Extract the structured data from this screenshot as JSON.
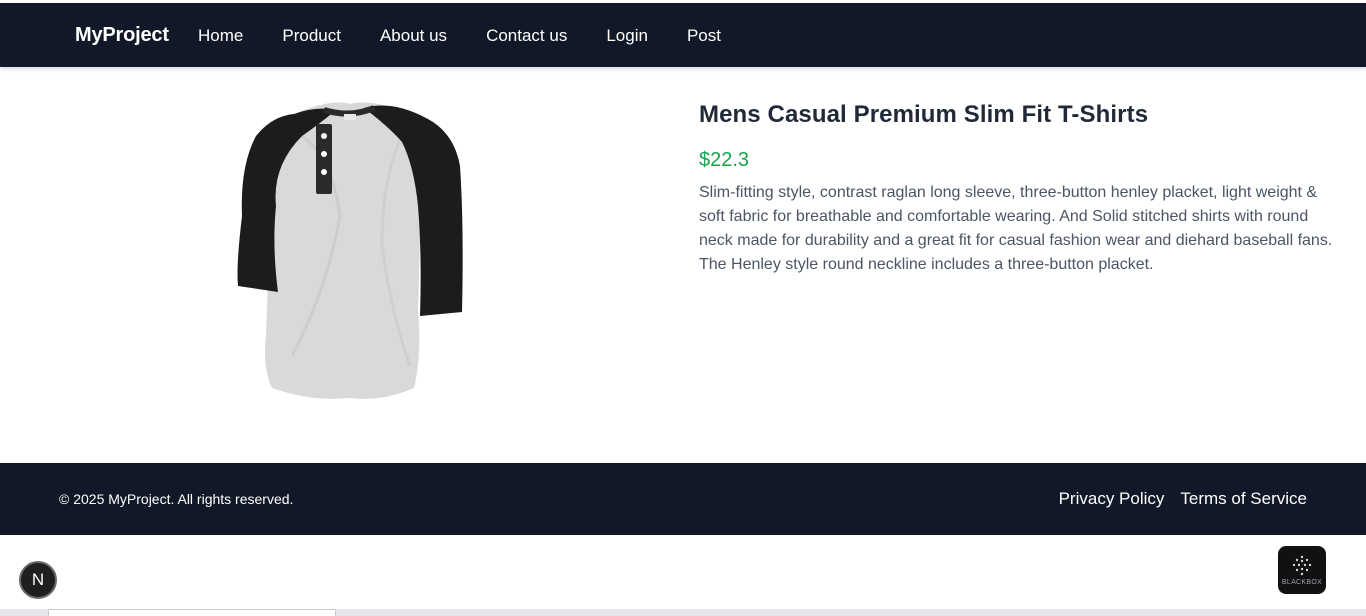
{
  "navbar": {
    "brand": "MyProject",
    "links": [
      "Home",
      "Product",
      "About us",
      "Contact us",
      "Login",
      "Post"
    ]
  },
  "product": {
    "image_alt": "Mens Casual Premium Slim Fit T-Shirts product image",
    "title": "Mens Casual Premium Slim Fit T-Shirts",
    "price": "$22.3",
    "description": "Slim-fitting style, contrast raglan long sleeve, three-button henley placket, light weight & soft fabric for breathable and comfortable wearing. And Solid stitched shirts with round neck made for durability and a great fit for casual fashion wear and diehard baseball fans. The Henley style round neckline includes a three-button placket."
  },
  "footer": {
    "copyright": "© 2025 MyProject. All rights reserved.",
    "links": [
      "Privacy Policy",
      "Terms of Service"
    ]
  },
  "overlays": {
    "next_badge": "N",
    "blackbox_label": "BLACKBOX"
  },
  "colors": {
    "nav_bg": "#111827",
    "price": "#16a34a",
    "text": "#1f2937",
    "muted_text": "#4b5563"
  }
}
